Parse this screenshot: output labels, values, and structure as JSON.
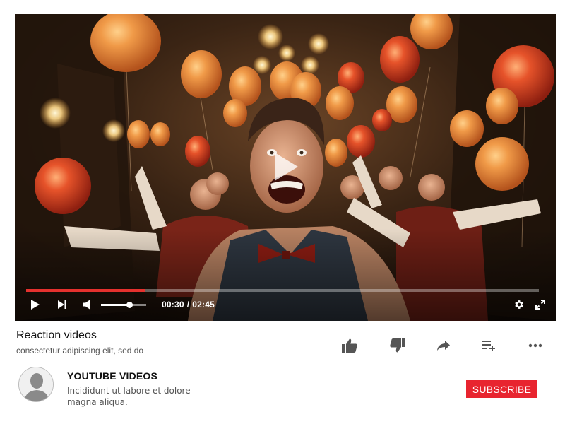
{
  "player": {
    "scene_description_icon": "party-scene-thumbnail",
    "progress_fraction": 0.233,
    "volume_fraction": 0.63,
    "current_time": "00:30",
    "time_separator": "/",
    "duration": "02:45",
    "accent_color": "#e5312e"
  },
  "video": {
    "title": "Reaction videos",
    "subtitle": "consectetur adipiscing elit, sed do"
  },
  "actions": {
    "like_icon": "thumbs-up-icon",
    "dislike_icon": "thumbs-down-icon",
    "share_icon": "share-icon",
    "add_icon": "add-to-playlist-icon",
    "more_icon": "more-options-icon"
  },
  "channel": {
    "name": "YOUTUBE VIDEOS",
    "description": "Incididunt ut labore et dolore magna aliqua.",
    "subscribe_label": "SUBSCRIBE",
    "subscribe_color": "#e8242f"
  }
}
